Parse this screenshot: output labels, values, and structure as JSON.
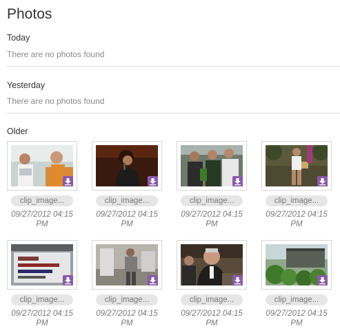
{
  "page": {
    "title": "Photos"
  },
  "sections": [
    {
      "label": "Today",
      "empty": "There are no photos found"
    },
    {
      "label": "Yesterday",
      "empty": "There are no photos found"
    },
    {
      "label": "Older"
    }
  ],
  "photos": [
    {
      "name": "clip_image...",
      "date": "09/27/2012 04:15",
      "time": "PM",
      "scene": "kids"
    },
    {
      "name": "clip_image...",
      "date": "09/27/2012 04:15",
      "time": "PM",
      "scene": "singer"
    },
    {
      "name": "clip_image...",
      "date": "09/27/2012 04:15",
      "time": "PM",
      "scene": "crowd"
    },
    {
      "name": "clip_image...",
      "date": "09/27/2012 04:15",
      "time": "PM",
      "scene": "street"
    },
    {
      "name": "clip_image...",
      "date": "09/27/2012 04:15",
      "time": "PM",
      "scene": "sign"
    },
    {
      "name": "clip_image...",
      "date": "09/27/2012 04:15",
      "time": "PM",
      "scene": "festival"
    },
    {
      "name": "clip_image...",
      "date": "09/27/2012 04:15",
      "time": "PM",
      "scene": "speaker"
    },
    {
      "name": "clip_image...",
      "date": "09/27/2012 04:15",
      "time": "PM",
      "scene": "garden"
    }
  ],
  "colors": {
    "badge": "#8a5aa7",
    "divider": "#dcdcdc",
    "muted_text": "#888888"
  },
  "icons": {
    "download": "download-arrow-icon"
  }
}
